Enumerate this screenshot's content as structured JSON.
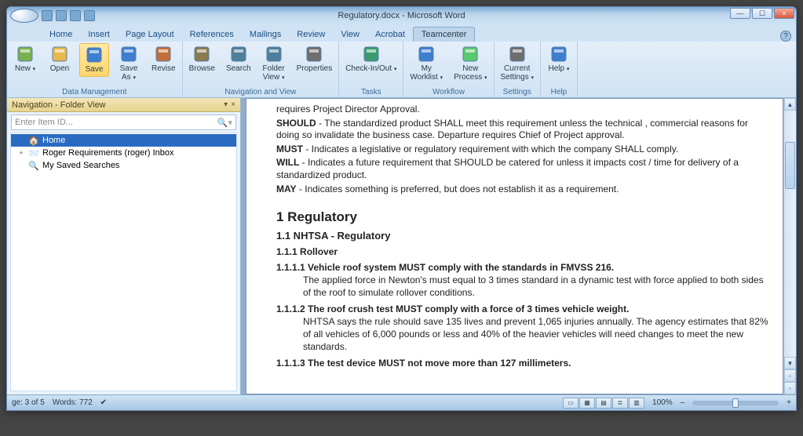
{
  "window": {
    "title": "Regulatory.docx - Microsoft Word",
    "controls": {
      "min": "—",
      "max": "☐",
      "close": "×"
    }
  },
  "tabs": {
    "items": [
      "Home",
      "Insert",
      "Page Layout",
      "References",
      "Mailings",
      "Review",
      "View",
      "Acrobat",
      "Teamcenter"
    ],
    "active": 8,
    "help": "?"
  },
  "ribbon": {
    "groups": [
      {
        "label": "Data Management",
        "items": [
          {
            "id": "new",
            "label": "New",
            "sub": ""
          },
          {
            "id": "open",
            "label": "Open"
          },
          {
            "id": "save",
            "label": "Save",
            "active": true
          },
          {
            "id": "saveas",
            "label": "Save\nAs"
          },
          {
            "id": "revise",
            "label": "Revise"
          }
        ]
      },
      {
        "label": "Navigation and View",
        "items": [
          {
            "id": "browse",
            "label": "Browse"
          },
          {
            "id": "search",
            "label": "Search"
          },
          {
            "id": "folderview",
            "label": "Folder\nView"
          },
          {
            "id": "properties",
            "label": "Properties"
          }
        ]
      },
      {
        "label": "Tasks",
        "items": [
          {
            "id": "checkinout",
            "label": "Check-In/Out"
          }
        ]
      },
      {
        "label": "Workflow",
        "items": [
          {
            "id": "myworklist",
            "label": "My\nWorklist"
          },
          {
            "id": "newprocess",
            "label": "New\nProcess"
          }
        ]
      },
      {
        "label": "Settings",
        "items": [
          {
            "id": "currentsettings",
            "label": "Current\nSettings"
          }
        ]
      },
      {
        "label": "Help",
        "items": [
          {
            "id": "help",
            "label": "Help"
          }
        ]
      }
    ]
  },
  "nav": {
    "title": "Navigation - Folder View",
    "search_placeholder": "Enter Item ID...",
    "tree": [
      {
        "label": "Home",
        "selected": true,
        "icon": "home"
      },
      {
        "label": "Roger Requirements (roger) Inbox",
        "icon": "inbox",
        "expander": "+"
      },
      {
        "label": "My Saved Searches",
        "icon": "search"
      }
    ]
  },
  "document": {
    "pre_heading": [
      {
        "pre": "",
        "text": "requires Project Director Approval."
      },
      {
        "pre": "SHOULD",
        "text": " - The standardized product SHALL meet this requirement unless the technical , commercial reasons for doing so invalidate the business case.  Departure requires Chief of Project approval."
      },
      {
        "pre": "MUST",
        "text": " - Indicates a legislative or regulatory requirement with which the company SHALL comply."
      },
      {
        "pre": "WILL",
        "text": " - Indicates a future requirement that SHOULD be catered for unless it impacts cost / time for delivery of a standardized product."
      },
      {
        "pre": "MAY",
        "text": " - Indicates something is preferred, but does not establish it as a requirement."
      }
    ],
    "h1": "1   Regulatory",
    "h2": "1.1   NHTSA - Regulatory",
    "h3": "1.1.1    Rollover",
    "sections": [
      {
        "title": "1.1.1.1    Vehicle roof system MUST comply with the standards in FMVSS 216.",
        "body": "The applied force in Newton's must equal to 3 times standard in a dynamic test with force applied to both sides of the roof to simulate rollover conditions."
      },
      {
        "title": "1.1.1.2    The roof crush test MUST comply with a force of 3 times vehicle weight.",
        "body": "NHTSA says the rule should save 135 lives and prevent 1,065 injuries annually. The agency estimates that 82% of all vehicles of 6,000 pounds or less and 40% of the heavier vehicles will need changes to meet the new standards."
      },
      {
        "title": "1.1.1.3    The test device MUST not move more than 127 millimeters.",
        "body": ""
      }
    ]
  },
  "status": {
    "page": "ge: 3 of 5",
    "words": "Words: 772",
    "zoom_label": "100%",
    "zoom_plus": "+",
    "zoom_minus": "–"
  },
  "icons": {
    "new": "#78b24e",
    "open": "#e7b84e",
    "save": "#3d7ecf",
    "saveas": "#3d7ecf",
    "revise": "#c36e3a",
    "browse": "#8a7a4e",
    "search": "#4e7f9a",
    "folderview": "#4e7f9a",
    "properties": "#6e6e6e",
    "checkinout": "#3b9a6e",
    "myworklist": "#3d7ecf",
    "newprocess": "#58c96e",
    "currentsettings": "#6e6e6e",
    "help": "#3d7ecf",
    "pin": "▾",
    "close_small": "×"
  }
}
